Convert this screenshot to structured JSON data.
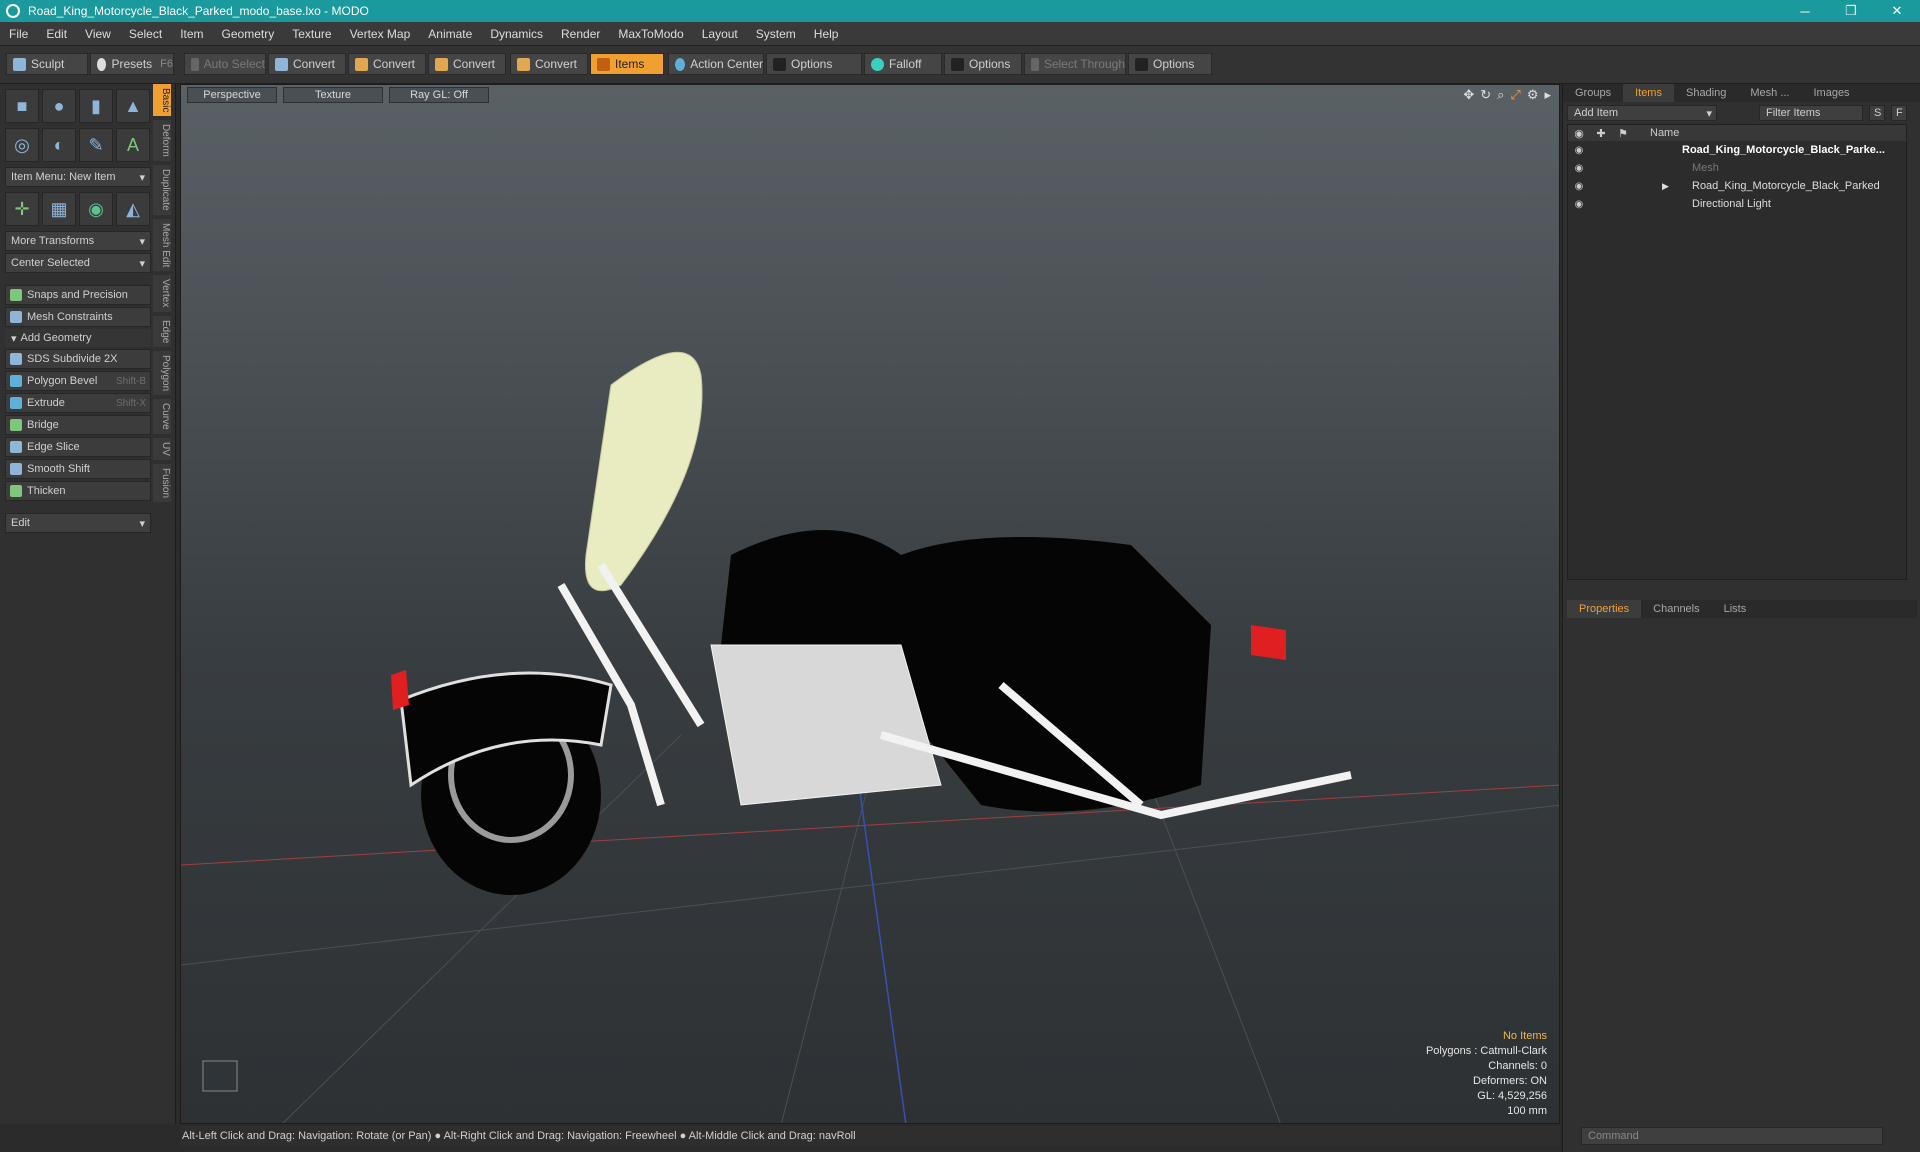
{
  "window": {
    "title": "Road_King_Motorcycle_Black_Parked_modo_base.lxo - MODO",
    "minimize": "─",
    "maximize": "❐",
    "close": "✕"
  },
  "menu": [
    "File",
    "Edit",
    "View",
    "Select",
    "Item",
    "Geometry",
    "Texture",
    "Vertex Map",
    "Animate",
    "Dynamics",
    "Render",
    "MaxToModo",
    "Layout",
    "System",
    "Help"
  ],
  "toolbar": {
    "sculpt": "Sculpt",
    "presets": "Presets",
    "presets_key": "F6",
    "auto_select": "Auto Select",
    "convert1": "Convert",
    "convert2": "Convert",
    "convert3": "Convert",
    "convert4": "Convert",
    "items": "Items",
    "action_center": "Action Center",
    "options1": "Options",
    "falloff": "Falloff",
    "options2": "Options",
    "select_through": "Select Through",
    "options3": "Options"
  },
  "left_panel": {
    "item_menu": "Item Menu: New Item",
    "more_transforms": "More Transforms",
    "center_selected": "Center Selected",
    "snaps": "Snaps and Precision",
    "mesh_constraints": "Mesh Constraints",
    "add_geometry": "Add Geometry",
    "tools": [
      {
        "label": "SDS Subdivide 2X",
        "shortcut": ""
      },
      {
        "label": "Polygon Bevel",
        "shortcut": "Shift-B"
      },
      {
        "label": "Extrude",
        "shortcut": "Shift-X"
      },
      {
        "label": "Bridge",
        "shortcut": ""
      },
      {
        "label": "Edge Slice",
        "shortcut": ""
      },
      {
        "label": "Smooth Shift",
        "shortcut": ""
      },
      {
        "label": "Thicken",
        "shortcut": ""
      }
    ],
    "edit_dropdown": "Edit",
    "vtabs": [
      "Basic",
      "Deform",
      "Duplicate",
      "Mesh Edit",
      "Vertex",
      "Edge",
      "Polygon",
      "Curve",
      "UV",
      "Fusion"
    ]
  },
  "viewport": {
    "view_mode": "Perspective",
    "shading": "Texture",
    "raygl": "Ray GL: Off",
    "stats": {
      "no_items": "No Items",
      "polygons": "Polygons : Catmull-Clark",
      "channels": "Channels: 0",
      "deformers": "Deformers: ON",
      "gl": "GL: 4,529,256",
      "scale": "100 mm"
    }
  },
  "status_bar": "Alt-Left Click and Drag: Navigation: Rotate (or Pan) ● Alt-Right Click and Drag: Navigation: Freewheel ● Alt-Middle Click and Drag: navRoll",
  "right_panel": {
    "tabs": [
      "Groups",
      "Items",
      "Shading",
      "Mesh ...",
      "Images"
    ],
    "add_item": "Add Item",
    "filter_items": "Filter Items",
    "s_btn": "S",
    "f_btn": "F",
    "name_col": "Name",
    "tree": [
      {
        "label": "Road_King_Motorcycle_Black_Parke...",
        "style": "bold"
      },
      {
        "label": "Mesh",
        "style": "dim"
      },
      {
        "label": "Road_King_Motorcycle_Black_Parked",
        "style": "normal"
      },
      {
        "label": "Directional Light",
        "style": "normal"
      }
    ],
    "props_tabs": [
      "Properties",
      "Channels",
      "Lists"
    ],
    "command_placeholder": "Command"
  },
  "colors": {
    "accent": "#f0a030",
    "titlebar": "#1a9a9c"
  }
}
